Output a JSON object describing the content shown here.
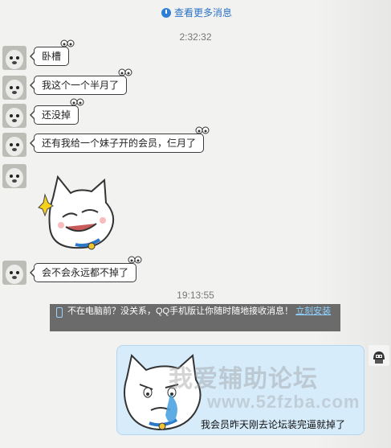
{
  "history": {
    "view_more_label": "查看更多消息"
  },
  "timestamps": [
    "2:32:32",
    "19:13:55"
  ],
  "messages": [
    {
      "text": "卧槽"
    },
    {
      "text": "我这个一个半月了"
    },
    {
      "text": "还没掉"
    },
    {
      "text": "还有我给一个妹子开的会员，仨月了"
    },
    {
      "text": "会不会永远都不掉了"
    }
  ],
  "promo": {
    "text": "不在电脑前？没关系，QQ手机版让你随时随地接收消息！",
    "link_label": "立刻安装"
  },
  "sticker_caption": "我会员昨天刚去论坛装完逼就掉了",
  "watermark": {
    "site_name": "我爱辅助论坛",
    "domain": "www.52fzba.com"
  },
  "colors": {
    "link": "#2b73c8",
    "promo_bg": "#6b6b6b",
    "sticker_bg": "#d6ecfb"
  }
}
